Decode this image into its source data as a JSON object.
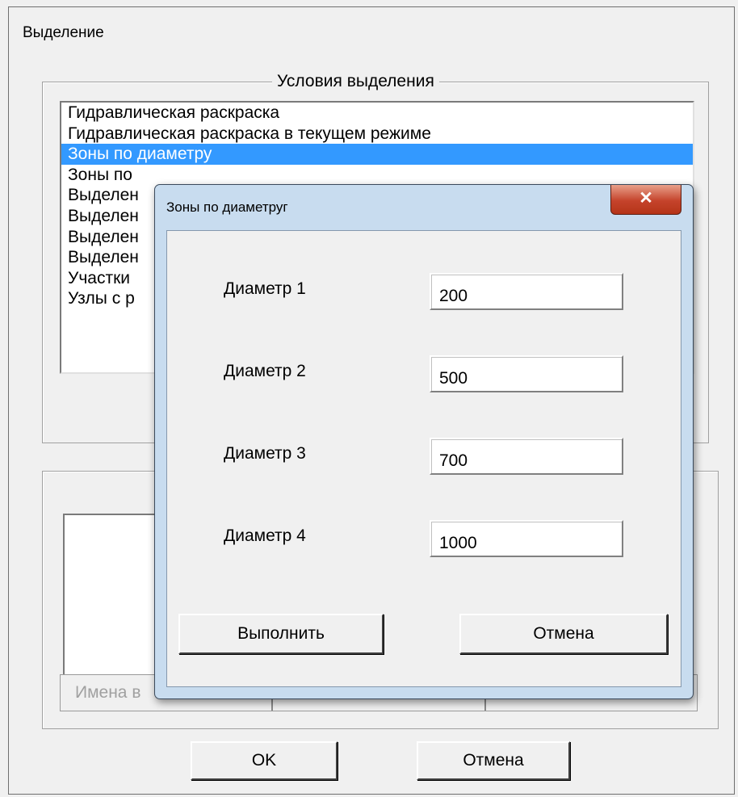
{
  "window": {
    "title": "Выделение"
  },
  "conditions": {
    "legend": "Условия  выделения",
    "items": [
      "Гидравлическая раскраска",
      "Гидравлическая раскраска в текущем режиме",
      "Зоны по диаметру",
      "Зоны по",
      "Выделен",
      "Выделен",
      "Выделен",
      "Выделен",
      "Участки",
      "Узлы с р"
    ],
    "selected_index": 2
  },
  "lower": {
    "header_cells": [
      "Имена в",
      "",
      ""
    ]
  },
  "buttons": {
    "ok": "OK",
    "cancel": "Отмена"
  },
  "modal": {
    "title": "Зоны по диаметруг",
    "close": "✕",
    "fields": [
      {
        "label": "Диаметр 1",
        "value": "200"
      },
      {
        "label": "Диаметр 2",
        "value": "500"
      },
      {
        "label": "Диаметр 3",
        "value": "700"
      },
      {
        "label": "Диаметр 4",
        "value": "1000"
      }
    ],
    "run_button": "Выполнить",
    "cancel_button": "Отмена"
  },
  "colors": {
    "selection": "#3399ff",
    "dialog_bg": "#f0f0f0",
    "close_button": "#c5432b",
    "modal_frame": "#c8dcef"
  }
}
